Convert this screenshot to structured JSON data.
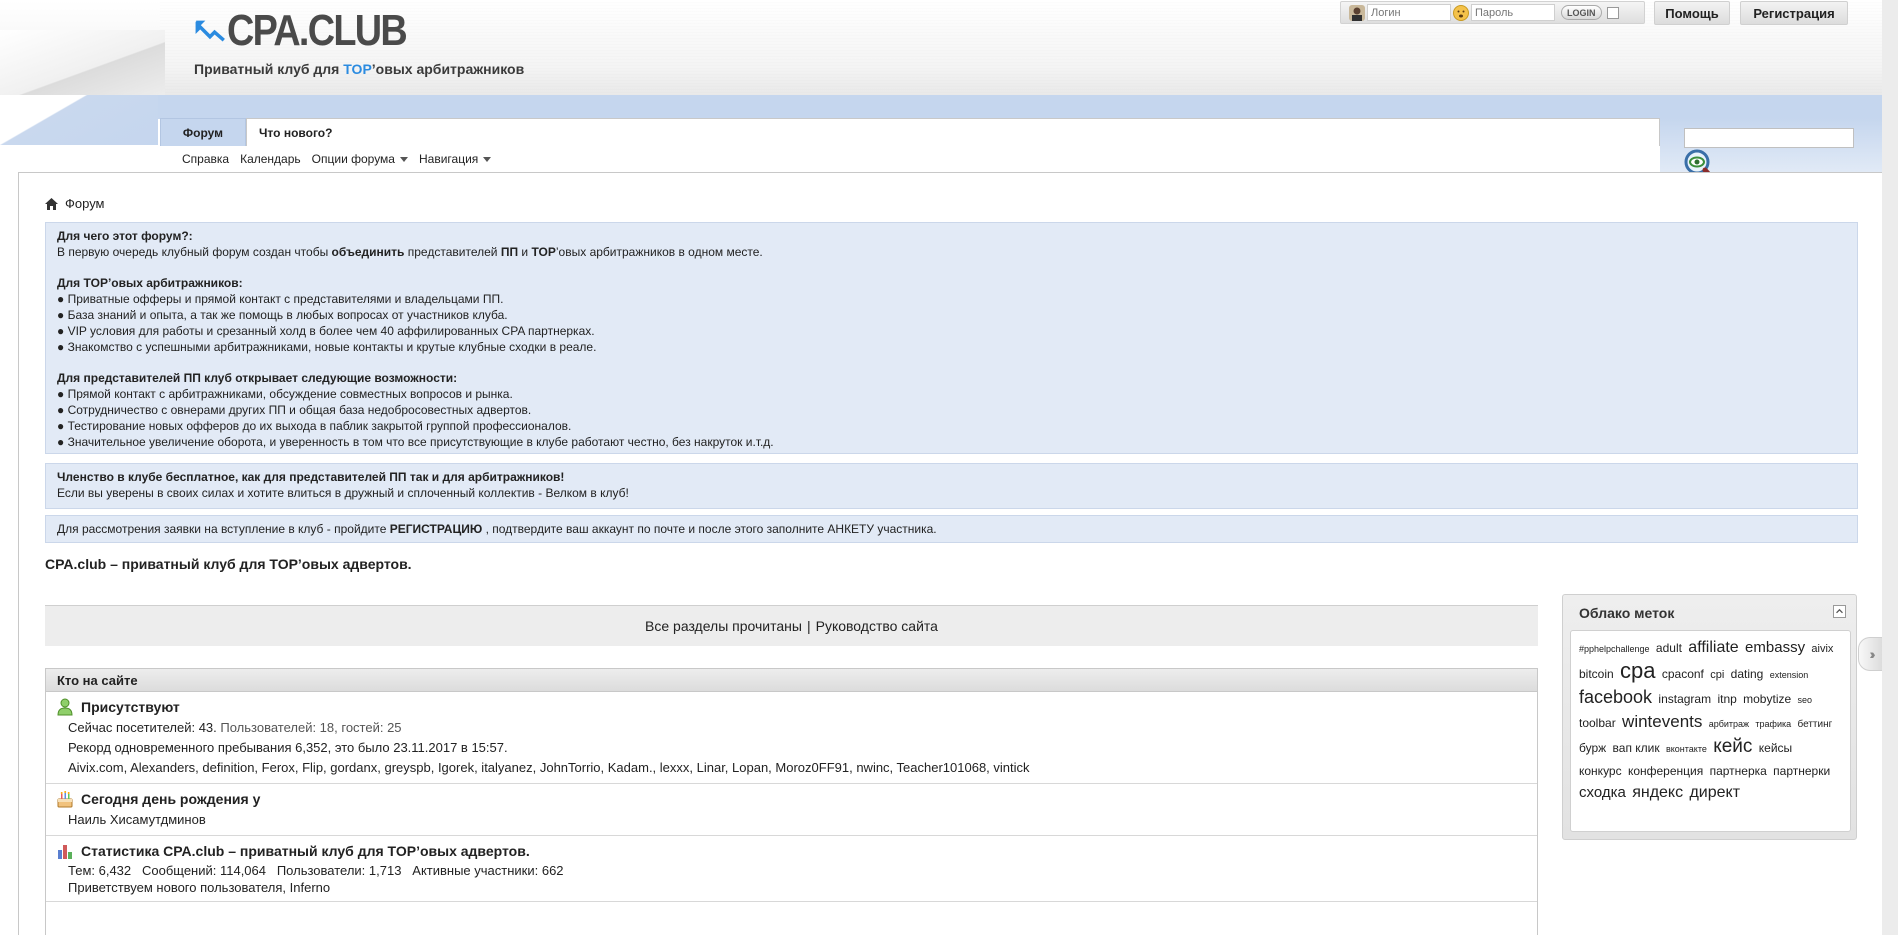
{
  "header": {
    "logo_text": "CPA.CLUB",
    "tagline_prefix": "Приватный клуб для ",
    "tagline_accent": "TOP",
    "tagline_suffix": "’овых арбитражников",
    "login_placeholder": "Логин",
    "password_placeholder": "Пароль",
    "login_button": "LOGIN",
    "help_button": "Помощь",
    "register_button": "Регистрация"
  },
  "nav": {
    "tabs": [
      {
        "label": "Форум",
        "active": true
      },
      {
        "label": "Что нового?",
        "active": false
      }
    ],
    "subnav": [
      {
        "label": "Справка"
      },
      {
        "label": "Календарь"
      },
      {
        "label": "Опции форума"
      },
      {
        "label": "Навигация"
      }
    ]
  },
  "breadcrumb": "Форум",
  "notice_about": {
    "q1": "Для чего этот форум?:",
    "l1_a": "В первую очередь клубный форум создан чтобы ",
    "l1_b": "объединить",
    "l1_c": " представителей ",
    "l1_d": "ПП",
    "l1_e": " и ",
    "l1_f": "TOP",
    "l1_g": "’овых арбитражников в одном месте.",
    "q2": "Для TOP’овых арбитражников:",
    "list2": [
      "● Приватные офферы и прямой контакт с представителями и владельцами ПП.",
      "● База знаний и опыта, а так же помощь в любых вопросах от участников клуба.",
      "● VIP условия для работы и срезанный холд в более чем 40 аффилированных CPA партнерках.",
      "● Знакомство с успешными арбитражниками, новые контакты и крутые клубные сходки в реале."
    ],
    "q3": "Для представителей ПП клуб открывает следующие возможности:",
    "list3": [
      "● Прямой контакт с арбитражниками, обсуждение совместных вопросов и рынка.",
      "● Сотрудничество с овнерами других ПП и общая база недобросовестных адвертов.",
      "● Тестирование новых офферов до их выхода в паблик закрытой группой профессионалов.",
      "● Значительное увеличение оборота, и уверенность в том что все присутствующие в клубе работают честно, без накруток и.т.д."
    ]
  },
  "notice_membership": {
    "title": "Членство в клубе бесплатное, как для представителей ПП так и для арбитражников!",
    "text": "Если вы уверены в своих силах и хотите влиться в дружный и сплоченный коллектив - Велком в клуб!"
  },
  "notice_registration": {
    "a": "Для рассмотрения заявки на вступление в клуб - пройдите ",
    "b": "РЕГИСТРАЦИЮ",
    "c": " , подтвердите ваш аккаунт по почте и после этого заполните АНКЕТУ участника."
  },
  "site_heading": "CPA.club – приватный клуб для TOP’овых адвертов.",
  "all_read": {
    "link1": "Все разделы прочитаны",
    "sep": "|",
    "link2": "Руководство сайта"
  },
  "online": {
    "header": "Кто на сайте",
    "present": {
      "title": "Присутствуют",
      "now_a": "Сейчас ",
      "now_b": "посетителей: 43.",
      "now_c": " Пользователей: 18, гостей: 25",
      "record": "Рекорд одновременного пребывания 6,352, это было 23.11.2017 в 15:57.",
      "users": "Aivix.com, Alexanders, definition, Ferox, Flip, gordanx, greyspb, Igorek, italyanez, JohnTorrio, Kadam., lexxx, Linar, Lopan, Moroz0FF91, nwinc, Teacher101068, vintick"
    },
    "birthday": {
      "title": "Сегодня день рождения у",
      "name": "Наиль Хисамутдминов"
    },
    "stats": {
      "title": "Статистика CPA.club – приватный клуб для TOP’овых адвертов.",
      "line1": "Тем: 6,432   Сообщений: 114,064   Пользователи: 1,713   Активные участники: 662",
      "line2_a": "Приветствуем нового пользователя, ",
      "line2_b": "Inferno"
    }
  },
  "tagcloud": {
    "title": "Облако меток",
    "tags": [
      {
        "text": "#pphelpchallenge",
        "size": 9
      },
      {
        "text": "adult",
        "size": 12
      },
      {
        "text": "affiliate",
        "size": 16
      },
      {
        "text": "embassy",
        "size": 15
      },
      {
        "text": "aivix",
        "size": 11
      },
      {
        "text": "bitcoin",
        "size": 12
      },
      {
        "text": "cpa",
        "size": 22
      },
      {
        "text": "cpaconf",
        "size": 12
      },
      {
        "text": "cpi",
        "size": 11
      },
      {
        "text": "dating",
        "size": 12
      },
      {
        "text": "extension",
        "size": 9
      },
      {
        "text": "facebook",
        "size": 18
      },
      {
        "text": "instagram",
        "size": 12
      },
      {
        "text": "itnp",
        "size": 12
      },
      {
        "text": "mobytize",
        "size": 12
      },
      {
        "text": "seo",
        "size": 9
      },
      {
        "text": "toolbar",
        "size": 12
      },
      {
        "text": "wintevents",
        "size": 17
      },
      {
        "text": "арбитраж",
        "size": 9
      },
      {
        "text": "трафика",
        "size": 9
      },
      {
        "text": "беттинг",
        "size": 10
      },
      {
        "text": "бурж",
        "size": 12
      },
      {
        "text": "вап клик",
        "size": 12
      },
      {
        "text": "вконтакте",
        "size": 9
      },
      {
        "text": "кейс",
        "size": 19
      },
      {
        "text": "кейсы",
        "size": 12
      },
      {
        "text": "конкурс",
        "size": 12
      },
      {
        "text": "конференция",
        "size": 12
      },
      {
        "text": "партнерка",
        "size": 12
      },
      {
        "text": "партнерки",
        "size": 12
      },
      {
        "text": "сходка",
        "size": 15
      },
      {
        "text": "яндекс",
        "size": 16
      },
      {
        "text": "директ",
        "size": 16
      }
    ]
  },
  "colors": {
    "brand_blue": "#2b8be0",
    "nav_blue": "#c5d6ee",
    "notice_bg": "#e2eaf6"
  },
  "icons": {
    "home": "home-icon",
    "search": "search-magnifier-icon",
    "present": "user-icon",
    "birthday": "cake-icon",
    "stats": "bar-chart-icon"
  }
}
